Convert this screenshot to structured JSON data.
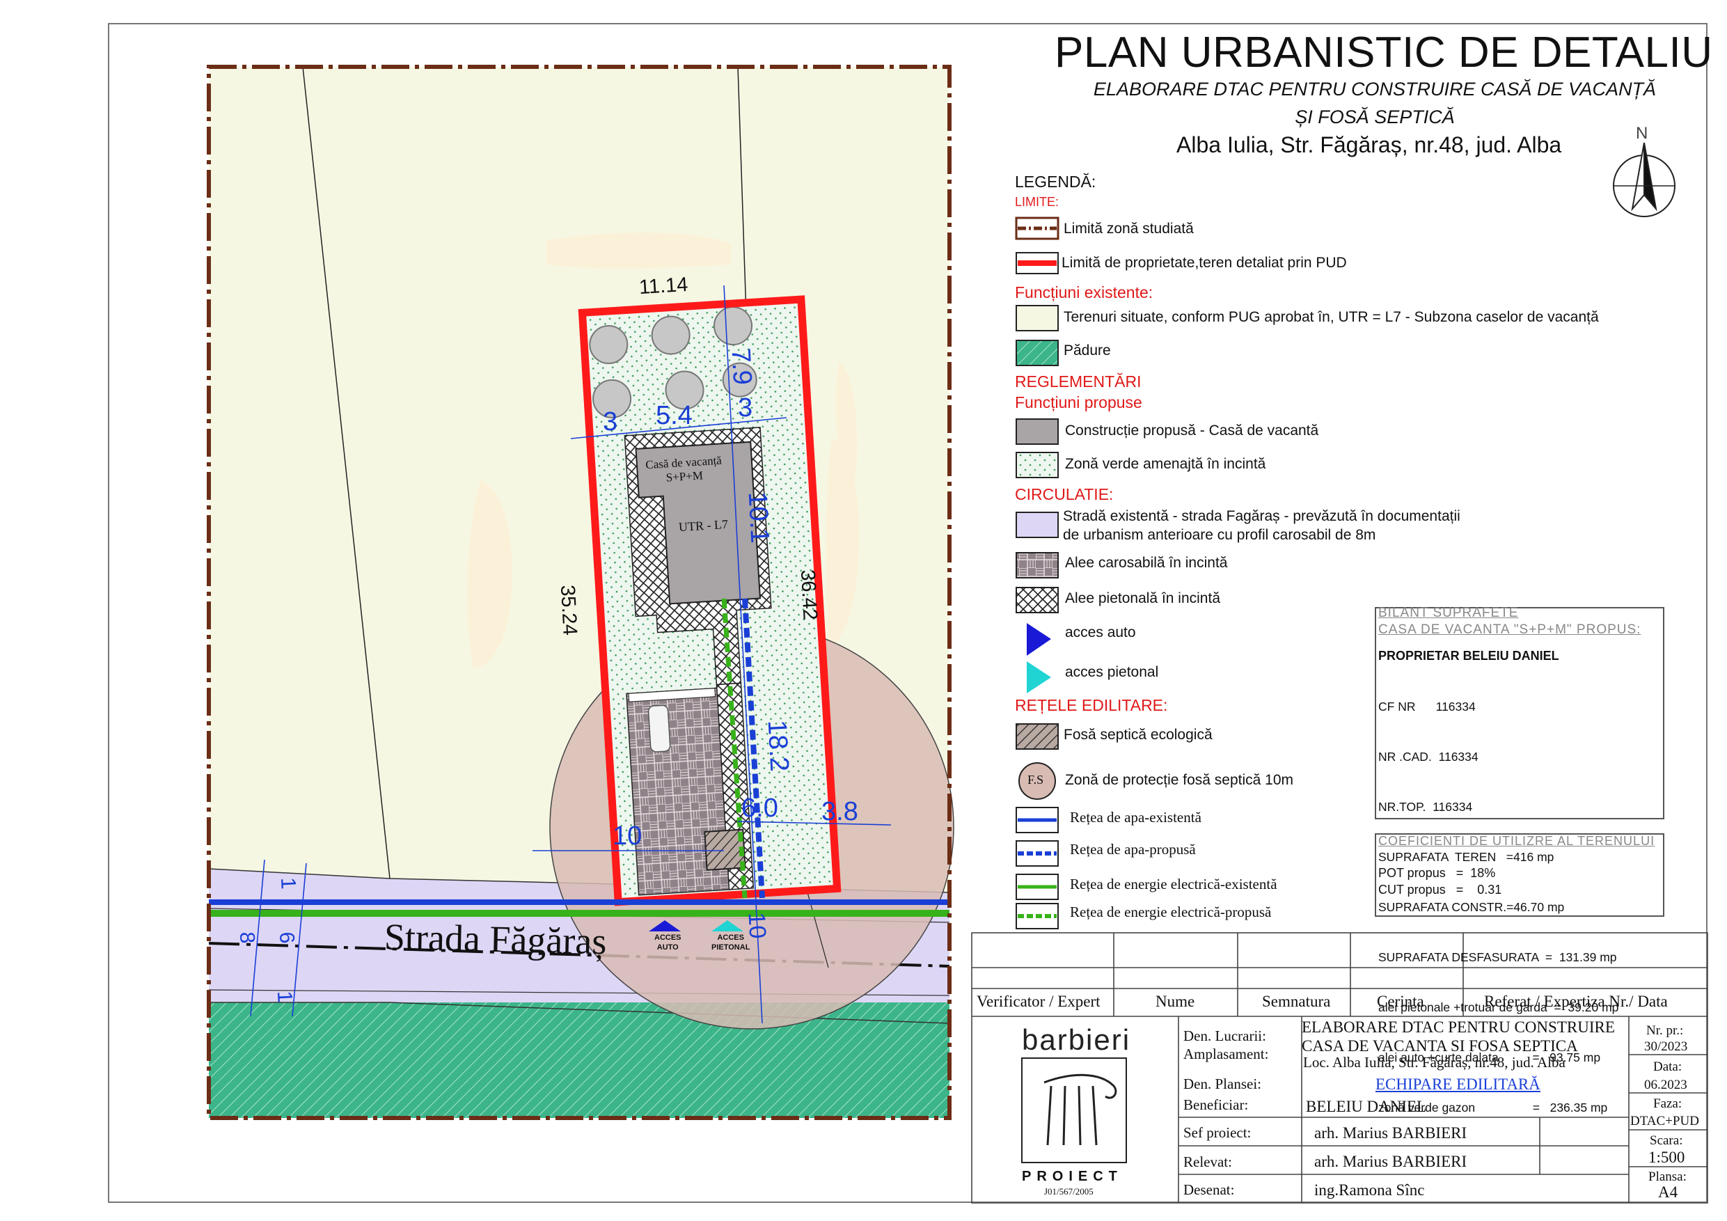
{
  "header": {
    "title": "PLAN URBANISTIC DE DETALIU",
    "subtitle_line1": "ELABORARE DTAC PENTRU CONSTRUIRE CASĂ DE VACANȚĂ",
    "subtitle_line2": "ȘI FOSĂ SEPTICĂ",
    "location": "Alba Iulia, Str. Făgăraș, nr.48, jud. Alba",
    "north": "N"
  },
  "legend": {
    "title": "LEGENDĂ:",
    "limits_heading": "LIMITE:",
    "limit_study": "Limită zonă studiată",
    "limit_property": "Limită de proprietate,teren detaliat prin PUD",
    "existing_heading": "Funcțiuni existente:",
    "existing_land": "Terenuri situate, conform PUG aprobat în, UTR = L7 - Subzona caselor de vacanță",
    "forest": "Pădure",
    "regulations_heading": "REGLEMENTĂRI",
    "proposed_heading": "Funcțiuni propuse",
    "proposed_building": "Construcție propusă - Casă de vacantă",
    "green_zone": "Zonă verde amenajtă în incintă",
    "circulation_heading": "CIRCULATIE:",
    "street_line1": "Stradă existentă - strada Fagăraș - prevăzută în documentații",
    "street_line2": "de urbanism anterioare cu profil carosabil de 8m",
    "car_alley": "Alee carosabilă în incintă",
    "ped_alley": "Alee pietonală în incintă",
    "car_access": "acces auto",
    "ped_access": "acces pietonal",
    "networks_heading": "REȚELE EDILITARE:",
    "septic": "Fosă septică ecologică",
    "septic_symbol": "F.S",
    "septic_zone": "Zonă de protecție fosă septică 10m",
    "water_existing": "Rețea de apa-existentă",
    "water_proposed": "Rețea de apa-propusă",
    "power_existing": "Rețea de energie electrică-existentă",
    "power_proposed": "Rețea de energie electrică-propusă"
  },
  "bilant": {
    "title_line1": "BILANT SUPRAFETE",
    "title_line2": "CASA DE VACANTA \"S+P+M\" PROPUS:",
    "owner": "PROPRIETAR BELEIU DANIEL",
    "rows": [
      "CF NR      116334",
      "NR .CAD.  116334",
      "NR.TOP.  116334",
      "SUPRAFATA  TEREN   =416 mp",
      "SUPRAFATA CONSTR.=46.70 mp",
      "SUPRAFATA DESFASURATA  =  131.39 mp",
      "alei pietonale +trotuar de garda  =  39.20 mp",
      "alei auto +curte dalata          =   93.75 mp",
      "zonă verde gazon                 =   236.35 mp"
    ],
    "coef_title": "COEFICIENTI  DE  UTILIZRE  AL  TERENULUI",
    "pot": "POT propus   =  18%",
    "cut": "CUT propus   =    0.31"
  },
  "map": {
    "street_name": "Strada Făgăraș",
    "house_label_line1": "Casă de vacanță",
    "house_label_line2": "S+P+M",
    "utr_label": "UTR - L7",
    "access_auto_1": "ACCES",
    "access_auto_2": "AUTO",
    "access_ped_1": "ACCES",
    "access_ped_2": "PIETONAL",
    "dims": {
      "top": "11.14",
      "left": "35.24",
      "right": "36.42",
      "d_79": "7.9",
      "d_3a": "3",
      "d_54": "5.4",
      "d_3b": "3",
      "d_101": "10.1",
      "d_182": "18.2",
      "d_60": "6.0",
      "d_38": "3.8",
      "d_10a": "10",
      "d_10b": "10",
      "street_1a": "1",
      "street_6": "6",
      "street_8": "8",
      "street_1b": "1"
    }
  },
  "title_block": {
    "headers": {
      "verifier": "Verificator / Expert",
      "name": "Nume",
      "signature": "Semnatura",
      "requirement": "Cerinta",
      "report": "Referat / Expertiza Nr./ Data"
    },
    "logo_top": "barbieri",
    "logo_bottom": "PROIECT",
    "logo_reg": "J01/567/2005",
    "labels": {
      "work": "Den. Lucrarii:",
      "site": "Amplasament:",
      "sheet": "Den. Plansei:",
      "client": "Beneficiar:",
      "chief": "Sef proiect:",
      "surveyed": "Relevat:",
      "drawn": "Desenat:"
    },
    "values": {
      "work_line1": "ELABORARE DTAC PENTRU CONSTRUIRE",
      "work_line2": "CASA DE VACANTA SI FOSA SEPTICA",
      "site": "Loc. Alba Iulia, Str. Făgăraș, nr.48, jud. Alba",
      "sheet": "ECHIPARE EDILITARĂ",
      "client": "BELEIU DANIEL",
      "chief": "arh. Marius BARBIERI",
      "surveyed": "arh. Marius BARBIERI",
      "drawn": "ing.Ramona Sînc"
    },
    "side": {
      "project_label": "Nr. pr.:",
      "project_value": "30/2023",
      "date_label": "Data:",
      "date_value": "06.2023",
      "phase_label": "Faza:",
      "phase_value": "DTAC+PUD",
      "scale_label": "Scara:",
      "scale_value": "1:500",
      "sheet_label": "Plansa:",
      "sheet_value": "A4"
    }
  },
  "colors": {
    "land": "#f6f7e3",
    "forest": "#3cb58a",
    "street": "#ddd6f5",
    "property": "#ff1a1a",
    "study_limit": "#6b2d16",
    "septic_zone": "#d8bcb4",
    "water": "#1a3fd6",
    "power": "#38b21a",
    "building": "#a9a4a6"
  }
}
